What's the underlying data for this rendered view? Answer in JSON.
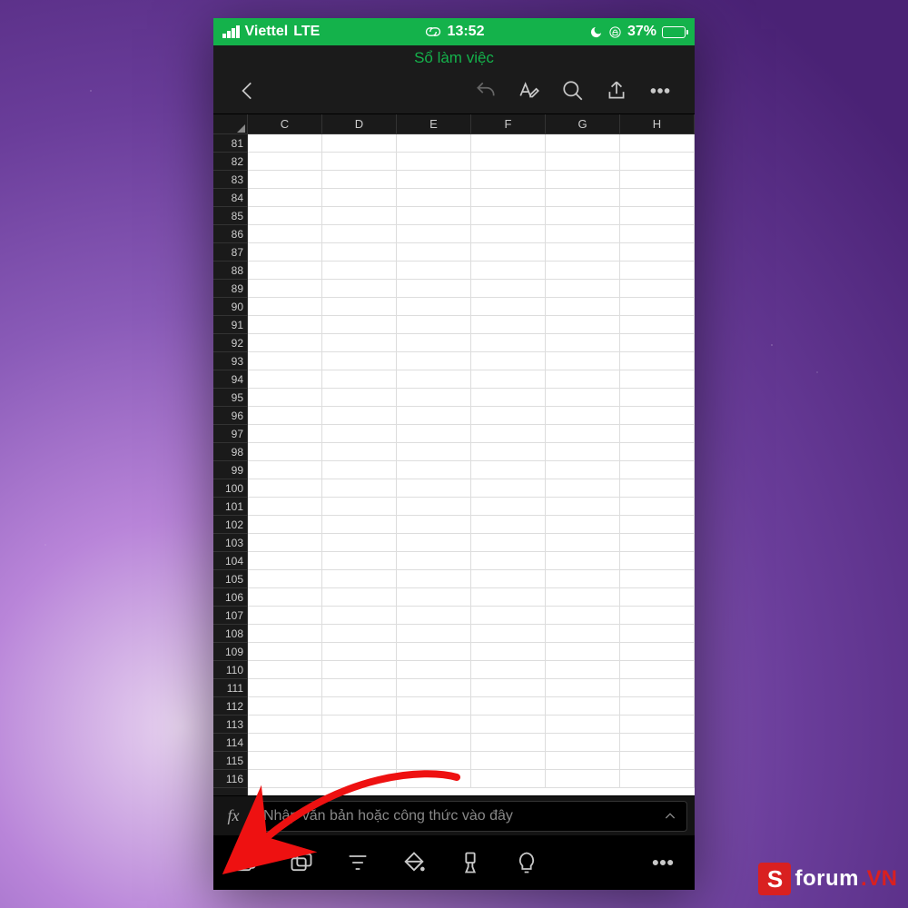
{
  "status": {
    "carrier": "Viettel",
    "network": "LTE",
    "time": "13:52",
    "battery_pct": "37%"
  },
  "doc": {
    "title": "Sổ làm việc"
  },
  "columns": [
    "C",
    "D",
    "E",
    "F",
    "G",
    "H"
  ],
  "row_start": 81,
  "row_end": 116,
  "formula": {
    "fx_label": "fx",
    "placeholder": "Nhập văn bản hoặc công thức vào đây"
  },
  "watermark": {
    "logo_letter": "S",
    "text": "forum",
    "suffix": ".VN"
  }
}
